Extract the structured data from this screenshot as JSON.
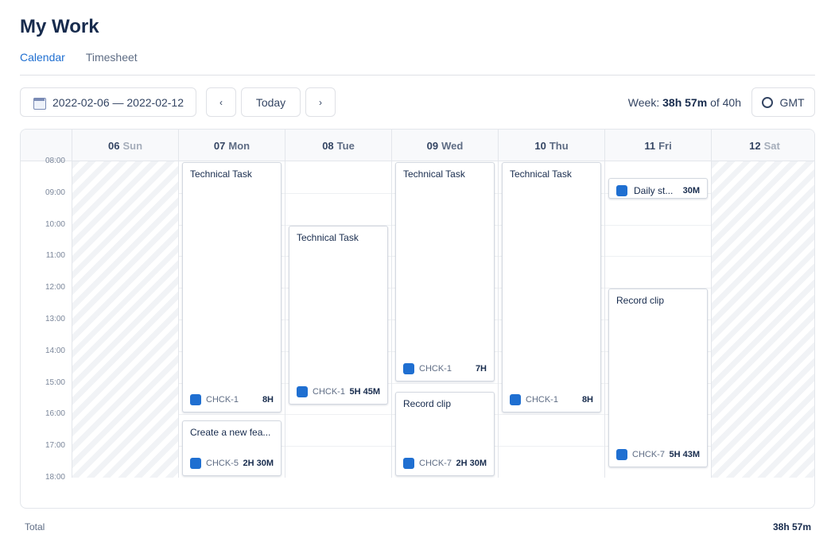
{
  "page": {
    "title": "My Work"
  },
  "tabs": [
    {
      "label": "Calendar",
      "active": true
    },
    {
      "label": "Timesheet",
      "active": false
    }
  ],
  "toolbar": {
    "date_range": "2022-02-06 — 2022-02-12",
    "prev_icon": "‹",
    "today_label": "Today",
    "next_icon": "›",
    "week_prefix": "Week:",
    "week_logged": "38h 57m",
    "week_of": "of 40h",
    "timezone_label": "GMT"
  },
  "days": [
    {
      "num": "06",
      "name": "Sun",
      "weekend": true
    },
    {
      "num": "07",
      "name": "Mon",
      "weekend": false
    },
    {
      "num": "08",
      "name": "Tue",
      "weekend": false
    },
    {
      "num": "09",
      "name": "Wed",
      "weekend": false
    },
    {
      "num": "10",
      "name": "Thu",
      "weekend": false
    },
    {
      "num": "11",
      "name": "Fri",
      "weekend": false
    },
    {
      "num": "12",
      "name": "Sat",
      "weekend": true
    }
  ],
  "hours": [
    "08:00",
    "09:00",
    "10:00",
    "11:00",
    "12:00",
    "13:00",
    "14:00",
    "15:00",
    "16:00",
    "17:00",
    "18:00"
  ],
  "events": [
    {
      "day": 1,
      "start": "08:00",
      "end": "16:00",
      "title": "Technical Task",
      "key": "CHCK-1",
      "duration": "8H"
    },
    {
      "day": 1,
      "start": "16:10",
      "end": "18:00",
      "title": "Create a new fea...",
      "key": "CHCK-5",
      "duration": "2H 30M"
    },
    {
      "day": 2,
      "start": "10:00",
      "end": "15:45",
      "title": "Technical Task",
      "key": "CHCK-1",
      "duration": "5H 45M"
    },
    {
      "day": 3,
      "start": "08:00",
      "end": "15:00",
      "title": "Technical Task",
      "key": "CHCK-1",
      "duration": "7H"
    },
    {
      "day": 3,
      "start": "15:15",
      "end": "18:00",
      "title": "Record clip",
      "key": "CHCK-7",
      "duration": "2H 30M"
    },
    {
      "day": 4,
      "start": "08:00",
      "end": "16:00",
      "title": "Technical Task",
      "key": "CHCK-1",
      "duration": "8H"
    },
    {
      "day": 5,
      "start": "08:30",
      "end": "09:00",
      "title": "Daily st...",
      "key": "",
      "duration": "30M",
      "inline": true
    },
    {
      "day": 5,
      "start": "12:00",
      "end": "17:43",
      "title": "Record clip",
      "key": "CHCK-7",
      "duration": "5H 43M"
    }
  ],
  "icons": {
    "calendar": "calendar-icon",
    "task": "task-type-icon",
    "timezone": "globe-circle-icon"
  },
  "colors": {
    "accent": "#1f6fd1",
    "task_icon": "#1f6fd1"
  },
  "footer": {
    "total_label": "Total",
    "total_value": "38h 57m"
  }
}
